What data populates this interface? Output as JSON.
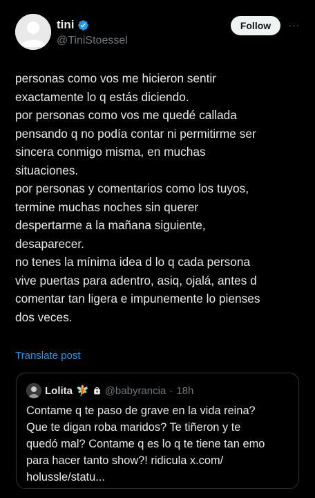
{
  "author": {
    "display_name": "tini",
    "handle": "@TiniStoessel",
    "verified_icon": "verified-badge-icon"
  },
  "actions": {
    "follow_label": "Follow",
    "more_label": "···"
  },
  "tweet": {
    "text": "personas como vos me hicieron sentir\nexactamente lo q estás diciendo.\npor personas como vos me quedé callada\npensando q no podía contar ni permitirme ser\nsincera conmigo misma, en muchas\nsituaciones.\npor personas y comentarios como los tuyos,\ntermine muchas noches sin querer\ndespertarme a la mañana siguiente,\ndesaparecer.\nno tenes la mínima idea d lo q cada persona\nvive puertas para adentro, asiq, ojalá, antes d\ncomentar tan ligera e impunemente lo pienses\ndos veces.",
    "translate_label": "Translate post"
  },
  "quoted": {
    "display_name": "Lolita",
    "emoji": "🧚",
    "handle": "@babyrancia",
    "separator": "·",
    "time": "18h",
    "text": "Contame q te paso de grave en la vida reina?\nQue te digan roba maridos? Te tiñeron y te\nquedó mal? Contame q es lo q te tiene tan emo\npara hacer tanto show?! ridicula x.com/\nholussle/statu..."
  },
  "colors": {
    "background": "#000000",
    "text": "#e7e9ea",
    "secondary": "#71767b",
    "link": "#1d9bf0",
    "verified": "#1d9bf0",
    "border": "#2f3336"
  }
}
